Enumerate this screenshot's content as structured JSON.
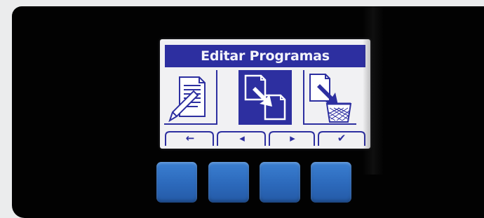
{
  "screen": {
    "title": "Editar Programas",
    "tiles": [
      {
        "icon": "edit-document-icon",
        "selected": false
      },
      {
        "icon": "copy-document-icon",
        "selected": true
      },
      {
        "icon": "delete-document-icon",
        "selected": false
      }
    ],
    "softkeys": [
      {
        "icon": "back-arrow-icon",
        "glyph": "←"
      },
      {
        "icon": "left-arrow-icon",
        "glyph": "◂"
      },
      {
        "icon": "right-arrow-icon",
        "glyph": "▸"
      },
      {
        "icon": "confirm-check-icon",
        "glyph": "✔"
      }
    ]
  },
  "hardware_buttons": [
    {
      "name": "hardware-button-1"
    },
    {
      "name": "hardware-button-2"
    },
    {
      "name": "hardware-button-3"
    },
    {
      "name": "hardware-button-4"
    }
  ],
  "colors": {
    "accent": "#2d2fa0",
    "screen_bg": "#f1f1f3",
    "button_blue": "#2c69bb",
    "device": "#020202"
  }
}
